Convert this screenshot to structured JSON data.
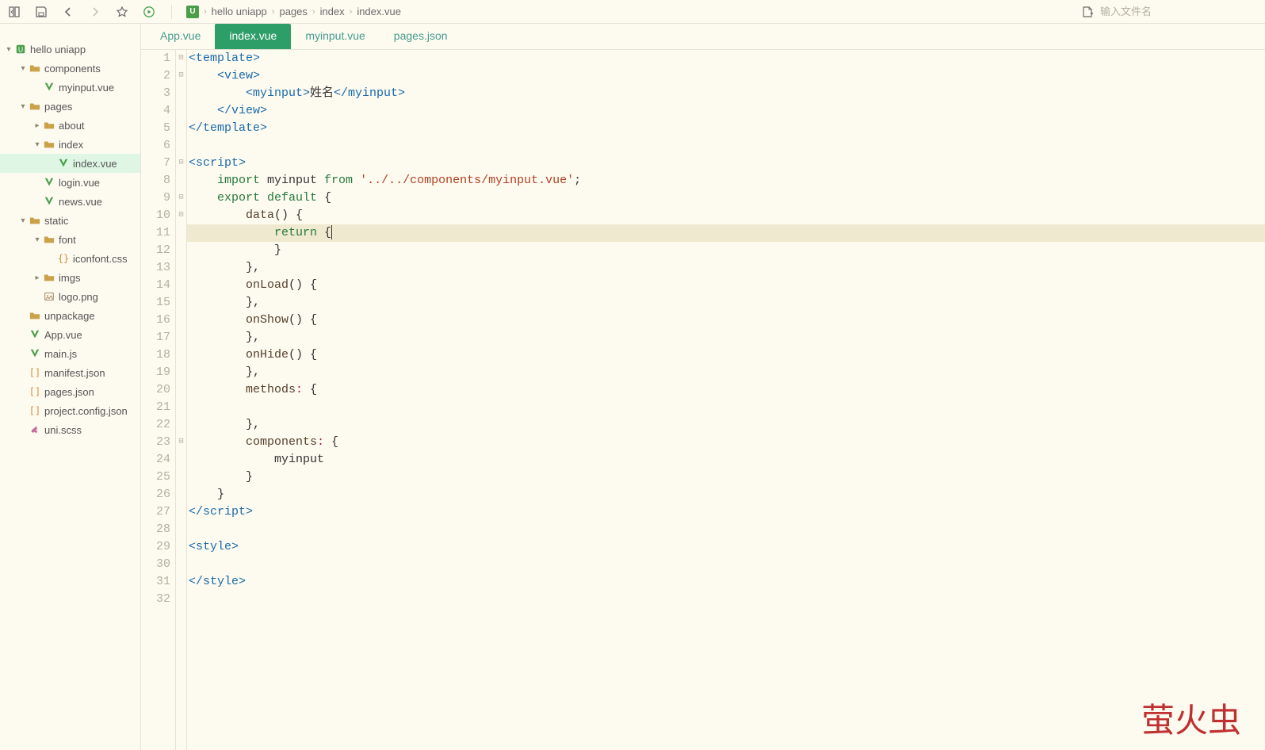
{
  "toolbar": {
    "search_placeholder": "输入文件名"
  },
  "breadcrumb": [
    "hello uniapp",
    "pages",
    "index",
    "index.vue"
  ],
  "tree": [
    {
      "label": "hello uniapp",
      "depth": 0,
      "arrow": "down",
      "icon": "root"
    },
    {
      "label": "components",
      "depth": 1,
      "arrow": "down",
      "icon": "folder"
    },
    {
      "label": "myinput.vue",
      "depth": 2,
      "arrow": "",
      "icon": "vue"
    },
    {
      "label": "pages",
      "depth": 1,
      "arrow": "down",
      "icon": "folder"
    },
    {
      "label": "about",
      "depth": 2,
      "arrow": "right",
      "icon": "folder"
    },
    {
      "label": "index",
      "depth": 2,
      "arrow": "down",
      "icon": "folder"
    },
    {
      "label": "index.vue",
      "depth": 3,
      "arrow": "",
      "icon": "vue",
      "selected": true
    },
    {
      "label": "login.vue",
      "depth": 2,
      "arrow": "",
      "icon": "vue"
    },
    {
      "label": "news.vue",
      "depth": 2,
      "arrow": "",
      "icon": "vue"
    },
    {
      "label": "static",
      "depth": 1,
      "arrow": "down",
      "icon": "folder"
    },
    {
      "label": "font",
      "depth": 2,
      "arrow": "down",
      "icon": "folder"
    },
    {
      "label": "iconfont.css",
      "depth": 3,
      "arrow": "",
      "icon": "css"
    },
    {
      "label": "imgs",
      "depth": 2,
      "arrow": "right",
      "icon": "folder"
    },
    {
      "label": "logo.png",
      "depth": 2,
      "arrow": "",
      "icon": "img"
    },
    {
      "label": "unpackage",
      "depth": 1,
      "arrow": "",
      "icon": "folder"
    },
    {
      "label": "App.vue",
      "depth": 1,
      "arrow": "",
      "icon": "vue"
    },
    {
      "label": "main.js",
      "depth": 1,
      "arrow": "",
      "icon": "vue"
    },
    {
      "label": "manifest.json",
      "depth": 1,
      "arrow": "",
      "icon": "brackets"
    },
    {
      "label": "pages.json",
      "depth": 1,
      "arrow": "",
      "icon": "brackets"
    },
    {
      "label": "project.config.json",
      "depth": 1,
      "arrow": "",
      "icon": "brackets"
    },
    {
      "label": "uni.scss",
      "depth": 1,
      "arrow": "",
      "icon": "scss"
    }
  ],
  "tabs": [
    {
      "label": "App.vue",
      "active": false
    },
    {
      "label": "index.vue",
      "active": true
    },
    {
      "label": "myinput.vue",
      "active": false
    },
    {
      "label": "pages.json",
      "active": false
    }
  ],
  "code": {
    "highlight_line": 11,
    "fold_markers": {
      "1": "⊟",
      "2": "⊟",
      "7": "⊟",
      "9": "⊟",
      "10": "⊟",
      "23": "⊟"
    },
    "lines": [
      {
        "n": 1,
        "tokens": [
          [
            "tag",
            "<template>"
          ]
        ]
      },
      {
        "n": 2,
        "tokens": [
          [
            "txt",
            "    "
          ],
          [
            "tag",
            "<view>"
          ]
        ]
      },
      {
        "n": 3,
        "tokens": [
          [
            "txt",
            "        "
          ],
          [
            "tag",
            "<myinput>"
          ],
          [
            "txt",
            "姓名"
          ],
          [
            "tag",
            "</myinput>"
          ]
        ]
      },
      {
        "n": 4,
        "tokens": [
          [
            "txt",
            "    "
          ],
          [
            "tag",
            "</view>"
          ]
        ]
      },
      {
        "n": 5,
        "tokens": [
          [
            "tag",
            "</template>"
          ]
        ]
      },
      {
        "n": 6,
        "tokens": [
          [
            "txt",
            ""
          ]
        ]
      },
      {
        "n": 7,
        "tokens": [
          [
            "tag",
            "<script>"
          ]
        ]
      },
      {
        "n": 8,
        "tokens": [
          [
            "txt",
            "    "
          ],
          [
            "kw",
            "import"
          ],
          [
            "txt",
            " myinput "
          ],
          [
            "kw",
            "from"
          ],
          [
            "txt",
            " "
          ],
          [
            "str",
            "'../../components/myinput.vue'"
          ],
          [
            "txt",
            ";"
          ]
        ]
      },
      {
        "n": 9,
        "tokens": [
          [
            "txt",
            "    "
          ],
          [
            "kw",
            "export"
          ],
          [
            "txt",
            " "
          ],
          [
            "kw",
            "default"
          ],
          [
            "txt",
            " {"
          ]
        ]
      },
      {
        "n": 10,
        "tokens": [
          [
            "txt",
            "        "
          ],
          [
            "fn",
            "data"
          ],
          [
            "txt",
            "() {"
          ]
        ]
      },
      {
        "n": 11,
        "tokens": [
          [
            "txt",
            "            "
          ],
          [
            "kw",
            "return"
          ],
          [
            "txt",
            " {"
          ]
        ]
      },
      {
        "n": 12,
        "tokens": [
          [
            "txt",
            "            }"
          ]
        ]
      },
      {
        "n": 13,
        "tokens": [
          [
            "txt",
            "        },"
          ]
        ]
      },
      {
        "n": 14,
        "tokens": [
          [
            "txt",
            "        "
          ],
          [
            "fn",
            "onLoad"
          ],
          [
            "txt",
            "() {"
          ]
        ]
      },
      {
        "n": 15,
        "tokens": [
          [
            "txt",
            "        },"
          ]
        ]
      },
      {
        "n": 16,
        "tokens": [
          [
            "txt",
            "        "
          ],
          [
            "fn",
            "onShow"
          ],
          [
            "txt",
            "() {"
          ]
        ]
      },
      {
        "n": 17,
        "tokens": [
          [
            "txt",
            "        },"
          ]
        ]
      },
      {
        "n": 18,
        "tokens": [
          [
            "txt",
            "        "
          ],
          [
            "fn",
            "onHide"
          ],
          [
            "txt",
            "() {"
          ]
        ]
      },
      {
        "n": 19,
        "tokens": [
          [
            "txt",
            "        },"
          ]
        ]
      },
      {
        "n": 20,
        "tokens": [
          [
            "txt",
            "        "
          ],
          [
            "fn",
            "methods"
          ],
          [
            "op",
            ":"
          ],
          [
            "txt",
            " {"
          ]
        ]
      },
      {
        "n": 21,
        "tokens": [
          [
            "txt",
            ""
          ]
        ]
      },
      {
        "n": 22,
        "tokens": [
          [
            "txt",
            "        },"
          ]
        ]
      },
      {
        "n": 23,
        "tokens": [
          [
            "txt",
            "        "
          ],
          [
            "fn",
            "components"
          ],
          [
            "op",
            ":"
          ],
          [
            "txt",
            " {"
          ]
        ]
      },
      {
        "n": 24,
        "tokens": [
          [
            "txt",
            "            myinput"
          ]
        ]
      },
      {
        "n": 25,
        "tokens": [
          [
            "txt",
            "        }"
          ]
        ]
      },
      {
        "n": 26,
        "tokens": [
          [
            "txt",
            "    }"
          ]
        ]
      },
      {
        "n": 27,
        "tokens": [
          [
            "tag",
            "</script>"
          ]
        ]
      },
      {
        "n": 28,
        "tokens": [
          [
            "txt",
            ""
          ]
        ]
      },
      {
        "n": 29,
        "tokens": [
          [
            "tag",
            "<style>"
          ]
        ]
      },
      {
        "n": 30,
        "tokens": [
          [
            "txt",
            ""
          ]
        ]
      },
      {
        "n": 31,
        "tokens": [
          [
            "tag",
            "</style>"
          ]
        ]
      },
      {
        "n": 32,
        "tokens": [
          [
            "txt",
            ""
          ]
        ]
      }
    ]
  },
  "watermark": "萤火虫"
}
